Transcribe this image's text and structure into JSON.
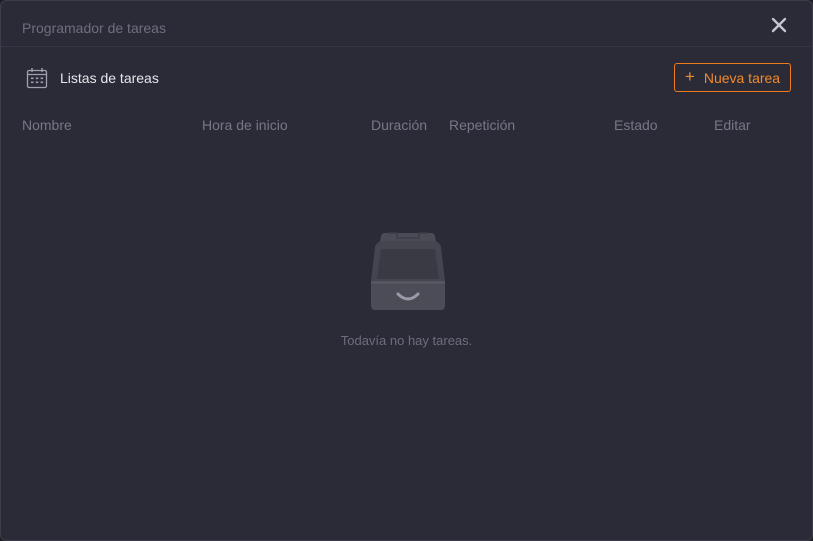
{
  "window": {
    "title": "Programador de tareas"
  },
  "section": {
    "title": "Listas de tareas",
    "icon": "calendar-icon"
  },
  "toolbar": {
    "new_task_label": "Nueva tarea",
    "new_task_symbol": "+",
    "accent": "#f07a1e"
  },
  "table": {
    "columns": [
      "Nombre",
      "Hora de inicio",
      "Duración",
      "Repetición",
      "Estado",
      "Editar"
    ]
  },
  "empty_state": {
    "icon": "empty-tray-icon",
    "message": "Todavía no hay tareas."
  }
}
